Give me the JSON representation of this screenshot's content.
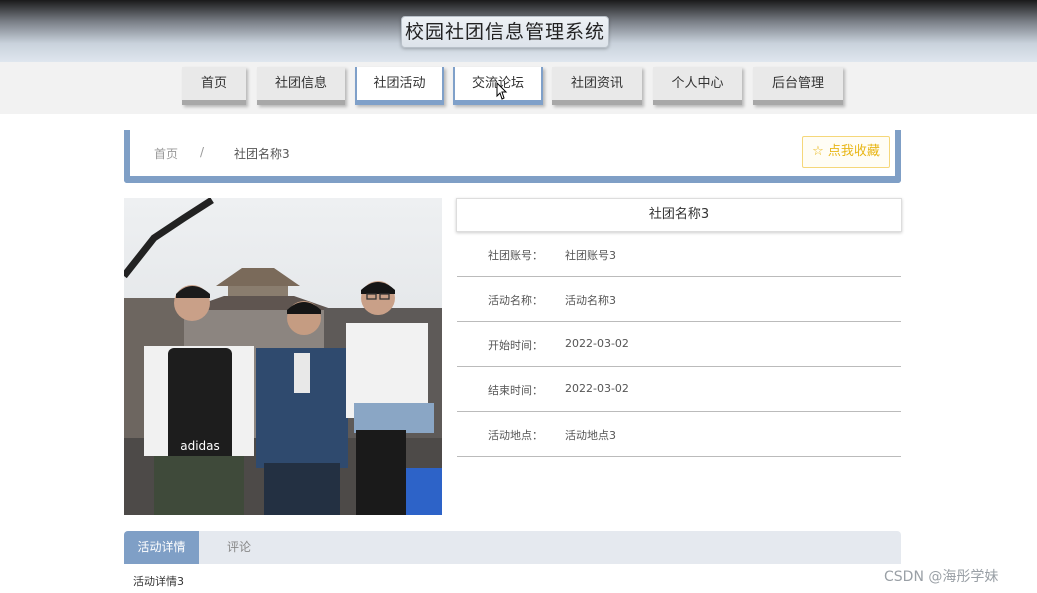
{
  "header": {
    "title": "校园社团信息管理系统"
  },
  "nav": {
    "items": [
      {
        "label": "首页"
      },
      {
        "label": "社团信息"
      },
      {
        "label": "社团活动"
      },
      {
        "label": "交流论坛"
      },
      {
        "label": "社团资讯"
      },
      {
        "label": "个人中心"
      },
      {
        "label": "后台管理"
      }
    ]
  },
  "breadcrumb": {
    "home": "首页",
    "separator": "/",
    "current": "社团名称3"
  },
  "favorite": {
    "label": "☆ 点我收藏",
    "color": "#e8b617"
  },
  "info": {
    "title": "社团名称3",
    "rows": [
      {
        "label": "社团账号：",
        "value": "社团账号3"
      },
      {
        "label": "活动名称：",
        "value": "活动名称3"
      },
      {
        "label": "开始时间：",
        "value": "2022-03-02"
      },
      {
        "label": "结束时间：",
        "value": "2022-03-02"
      },
      {
        "label": "活动地点：",
        "value": "活动地点3"
      }
    ]
  },
  "tabs": [
    {
      "label": "活动详情"
    },
    {
      "label": "评论"
    }
  ],
  "detail": {
    "text": "活动详情3"
  },
  "photo": {
    "bag_text": "adidas"
  },
  "watermark": "CSDN @海彤学妹",
  "colors": {
    "accent": "#7f9fc6",
    "nav_bg": "#e9e9e9"
  }
}
